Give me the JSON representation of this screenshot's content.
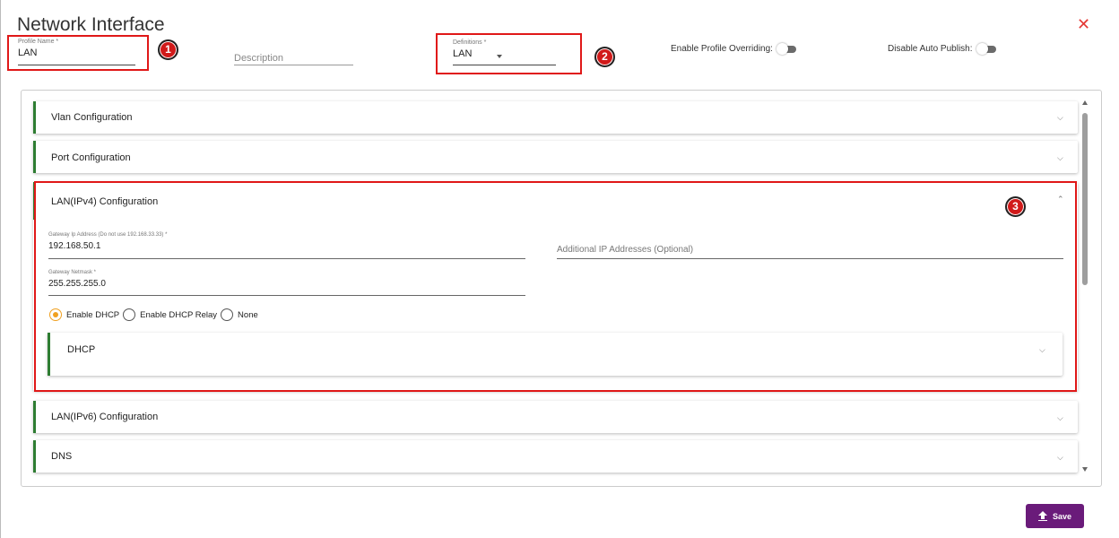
{
  "dialog": {
    "title": "Network Interface",
    "close_icon": "close-icon",
    "close_glyph": "✕"
  },
  "form": {
    "profile_name": {
      "label": "Profile Name *",
      "value": "LAN"
    },
    "description": {
      "placeholder": "Description"
    },
    "definitions": {
      "label": "Definitions *",
      "value": "LAN"
    },
    "enable_profile_overriding": {
      "label": "Enable Profile Overriding:",
      "state": "off"
    },
    "disable_auto_publish": {
      "label": "Disable Auto Publish:",
      "state": "off"
    }
  },
  "annotations": [
    {
      "number": "1",
      "color": "#d11a1a"
    },
    {
      "number": "2",
      "color": "#d11a1a"
    },
    {
      "number": "3",
      "color": "#d11a1a"
    }
  ],
  "sections": {
    "vlan": {
      "label": "Vlan Configuration",
      "expanded": false
    },
    "port": {
      "label": "Port Configuration",
      "expanded": false
    },
    "ipv4": {
      "label": "LAN(IPv4) Configuration",
      "expanded": true,
      "gateway_ip": {
        "label": "Gateway Ip Address (Do not use 192.168.33.33) *",
        "value": "192.168.50.1"
      },
      "additional_ip": {
        "placeholder": "Additional IP Addresses (Optional)"
      },
      "gateway_netmask": {
        "label": "Gateway Netmask *",
        "value": "255.255.255.0"
      },
      "dhcp_mode": {
        "options": [
          "Enable DHCP",
          "Enable DHCP Relay",
          "None"
        ],
        "selected": "Enable DHCP"
      },
      "dhcp": {
        "label": "DHCP",
        "expanded": false
      }
    },
    "ipv6": {
      "label": "LAN(IPv6) Configuration",
      "expanded": false
    },
    "dns": {
      "label": "DNS",
      "expanded": false
    }
  },
  "chevrons": {
    "down": "⌵",
    "up": "⌃"
  },
  "actions": {
    "save_label": "Save",
    "save_icon": "upload-icon"
  },
  "colors": {
    "accent_bar": "#2e7d32",
    "save_button": "#6a1b7a",
    "radio_selected": "#f0a020",
    "highlight_box": "#e01818",
    "close": "#e53935"
  }
}
